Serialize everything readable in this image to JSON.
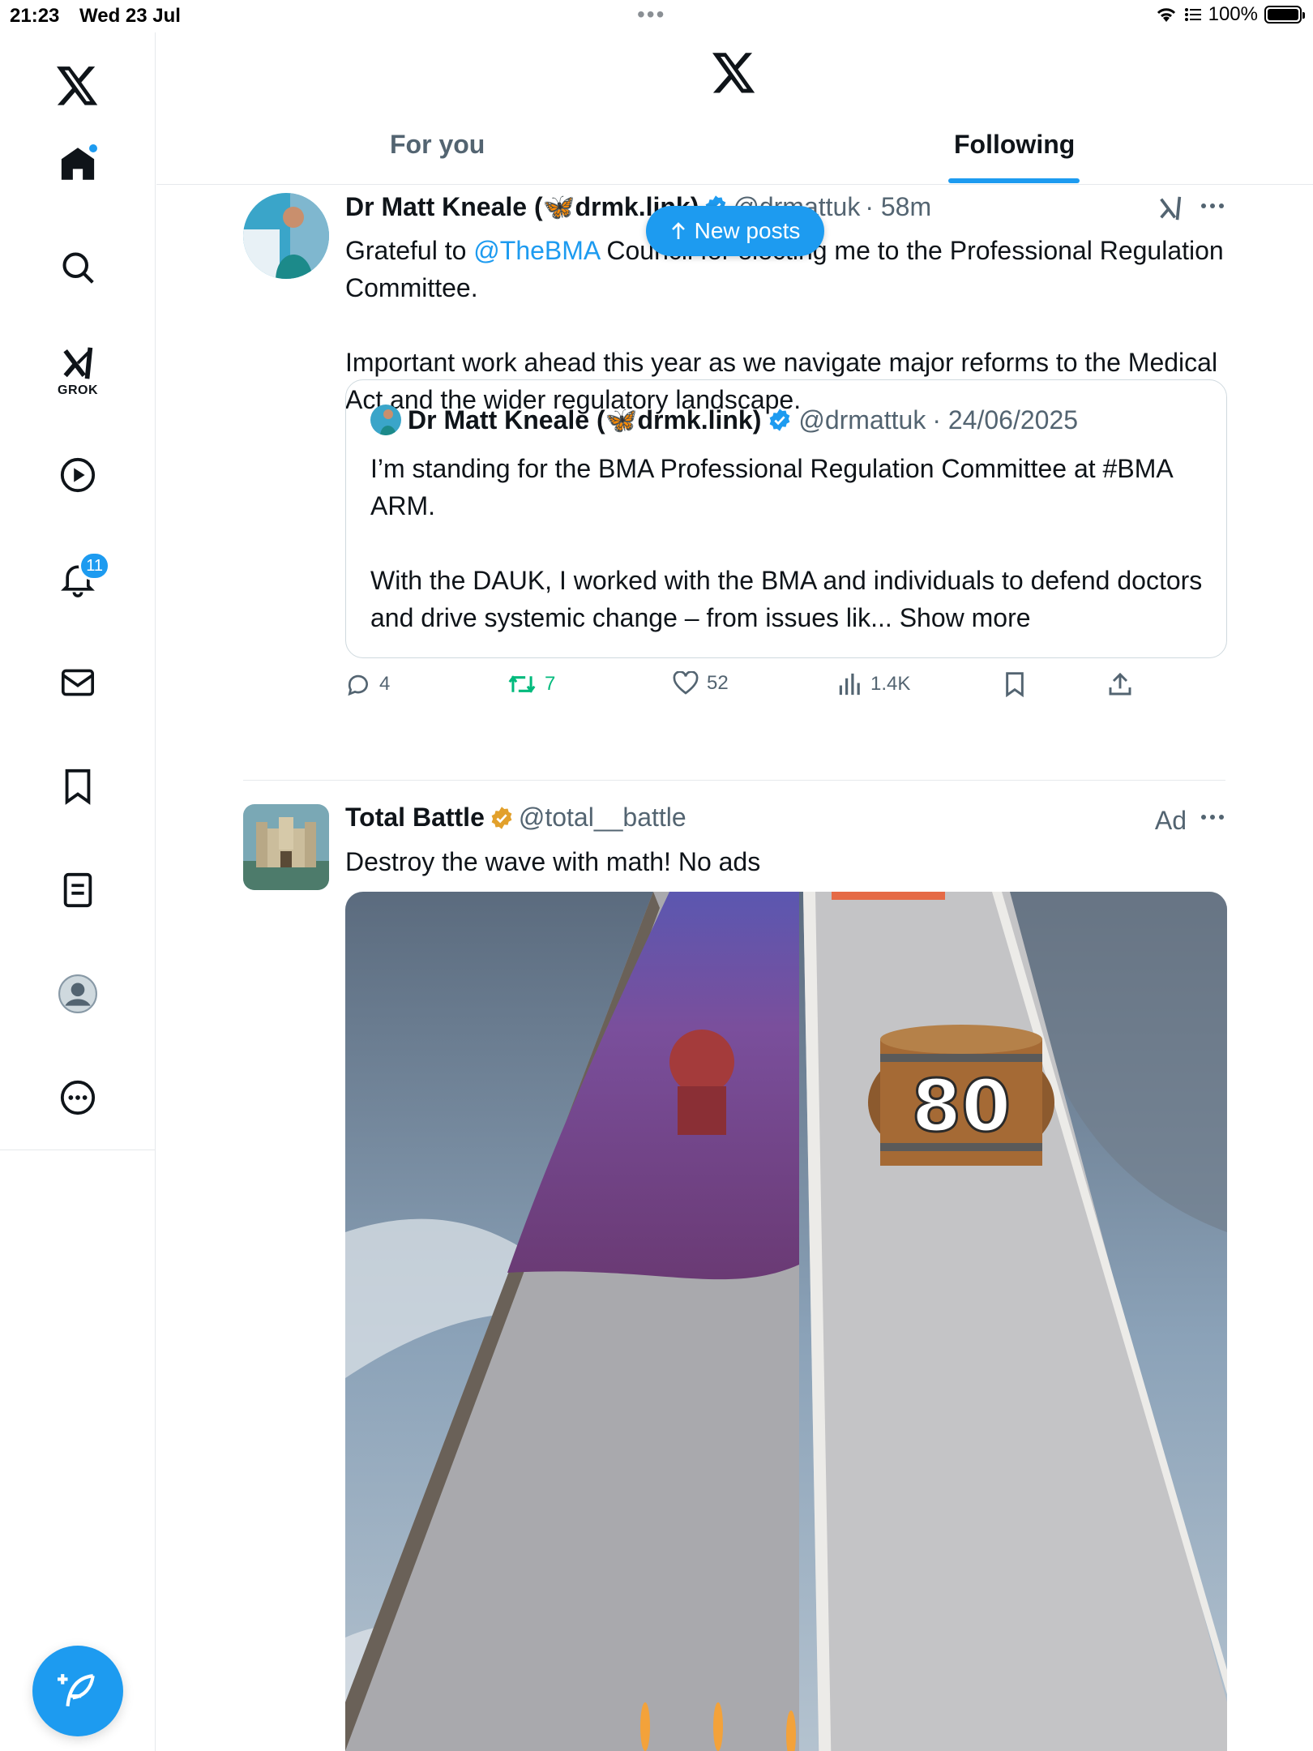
{
  "status_bar": {
    "time": "21:23",
    "date": "Wed 23 Jul",
    "battery": "100%"
  },
  "sidebar": {
    "items": [
      {
        "name": "home",
        "icon": "home-icon"
      },
      {
        "name": "explore",
        "icon": "search-icon"
      },
      {
        "name": "grok",
        "icon": "grok-icon",
        "label": "GROK"
      },
      {
        "name": "video",
        "icon": "play-icon"
      },
      {
        "name": "notifications",
        "icon": "bell-icon",
        "badge": "11"
      },
      {
        "name": "messages",
        "icon": "mail-icon"
      },
      {
        "name": "bookmarks",
        "icon": "bookmark-icon"
      },
      {
        "name": "lists",
        "icon": "list-icon"
      },
      {
        "name": "profile",
        "icon": "avatar-icon"
      },
      {
        "name": "more",
        "icon": "more-circle-icon"
      }
    ]
  },
  "header": {
    "tabs": [
      {
        "label": "For you",
        "active": false
      },
      {
        "label": "Following",
        "active": true
      }
    ]
  },
  "new_posts_label": "New posts",
  "tweets": [
    {
      "name": "Dr Matt Kneale (🦋drmk.link)",
      "handle": "@drmattuk",
      "time": "· 58m",
      "body_prefix": "Grateful to ",
      "mention": "@TheBMA",
      "body_suffix": " Council for electing me to the Professional Regulation Committee.\n\nImportant work ahead this year as we navigate major reforms to the Medical Act and the wider regulatory landscape.",
      "quote": {
        "name": "Dr Matt Kneale (🦋drmk.link)",
        "handle": "@drmattuk",
        "time": "· 24/06/2025",
        "body": "I’m standing for the BMA Professional Regulation Committee at #BMA ARM.\n\nWith the DAUK, I worked with the BMA and individuals to defend doctors and drive systemic change – from issues lik...",
        "show_more": "Show more"
      },
      "stats": {
        "replies": "4",
        "reposts": "7",
        "likes": "52",
        "views": "1.4K"
      }
    },
    {
      "name": "Total Battle",
      "handle": "@total__battle",
      "ad_label": "Ad",
      "body": "Destroy the wave with math! No ads",
      "media_text": "80"
    }
  ],
  "colors": {
    "accent": "#1d9bf0",
    "repost": "#00ba7c",
    "secondary": "#536471",
    "gold_verified": "#e2a02b"
  }
}
